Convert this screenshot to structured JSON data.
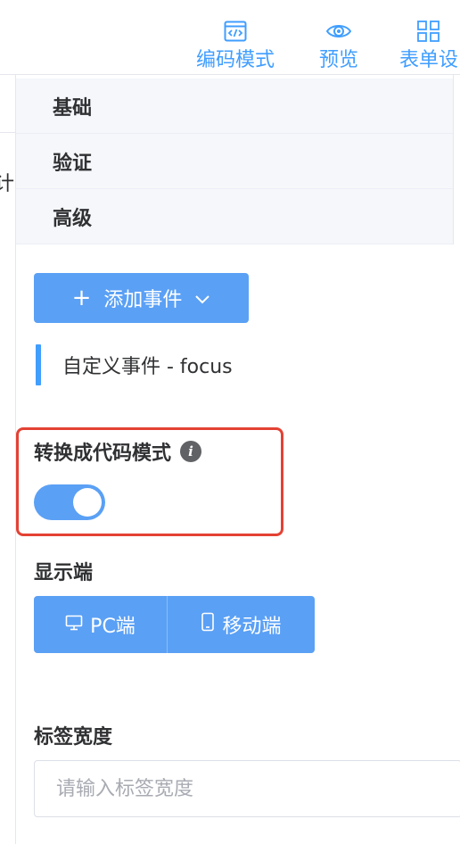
{
  "toolbar": {
    "code_mode": "编码模式",
    "preview": "预览",
    "form": "表单设"
  },
  "left": {
    "cut_text": "计"
  },
  "collapse": [
    {
      "label": "基础"
    },
    {
      "label": "验证"
    },
    {
      "label": "高级"
    }
  ],
  "add_event": {
    "label": "添加事件"
  },
  "event": {
    "text": "自定义事件 - focus"
  },
  "code_mode_switch": {
    "label": "转换成代码模式",
    "on": true
  },
  "display": {
    "label": "显示端",
    "pc": "PC端",
    "mobile": "移动端"
  },
  "label_width": {
    "label": "标签宽度",
    "placeholder": "请输入标签宽度"
  },
  "colors": {
    "primary": "#409eff",
    "button": "#5aa0f5",
    "highlight": "#e34234"
  }
}
